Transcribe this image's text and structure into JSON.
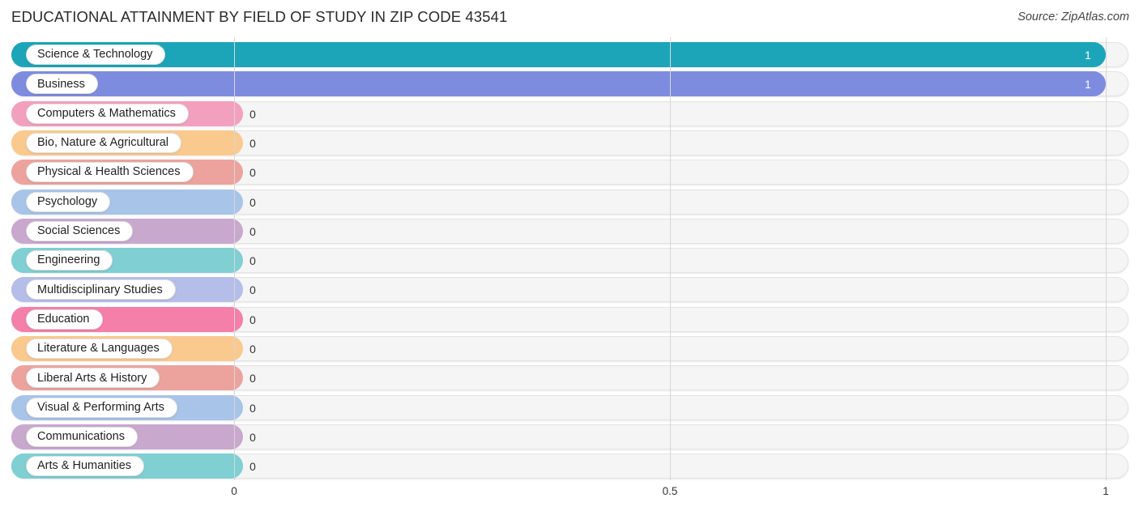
{
  "header": {
    "title": "EDUCATIONAL ATTAINMENT BY FIELD OF STUDY IN ZIP CODE 43541",
    "source": "Source: ZipAtlas.com"
  },
  "chart_data": {
    "type": "bar",
    "orientation": "horizontal",
    "title": "EDUCATIONAL ATTAINMENT BY FIELD OF STUDY IN ZIP CODE 43541",
    "xlabel": "",
    "ylabel": "",
    "xlim": [
      0,
      1
    ],
    "grid": true,
    "legend": false,
    "tick_labels": [
      "0",
      "0.5",
      "1"
    ],
    "tick_values": [
      0,
      0.5,
      1
    ],
    "categories": [
      "Science & Technology",
      "Business",
      "Computers & Mathematics",
      "Bio, Nature & Agricultural",
      "Physical & Health Sciences",
      "Psychology",
      "Social Sciences",
      "Engineering",
      "Multidisciplinary Studies",
      "Education",
      "Literature & Languages",
      "Liberal Arts & History",
      "Visual & Performing Arts",
      "Communications",
      "Arts & Humanities"
    ],
    "values": [
      1,
      1,
      0,
      0,
      0,
      0,
      0,
      0,
      0,
      0,
      0,
      0,
      0,
      0,
      0
    ],
    "value_labels": [
      "1",
      "1",
      "0",
      "0",
      "0",
      "0",
      "0",
      "0",
      "0",
      "0",
      "0",
      "0",
      "0",
      "0",
      "0"
    ],
    "colors": [
      "#1CA5B8",
      "#7E8CE0",
      "#F3A0BE",
      "#FAC98E",
      "#ECA39E",
      "#A8C4E8",
      "#C9A8CE",
      "#7FCFD3",
      "#B4BEE8",
      "#F47FA8",
      "#FAC98E",
      "#ECA39E",
      "#A8C4E8",
      "#C9A8CE",
      "#7FCFD3"
    ]
  }
}
